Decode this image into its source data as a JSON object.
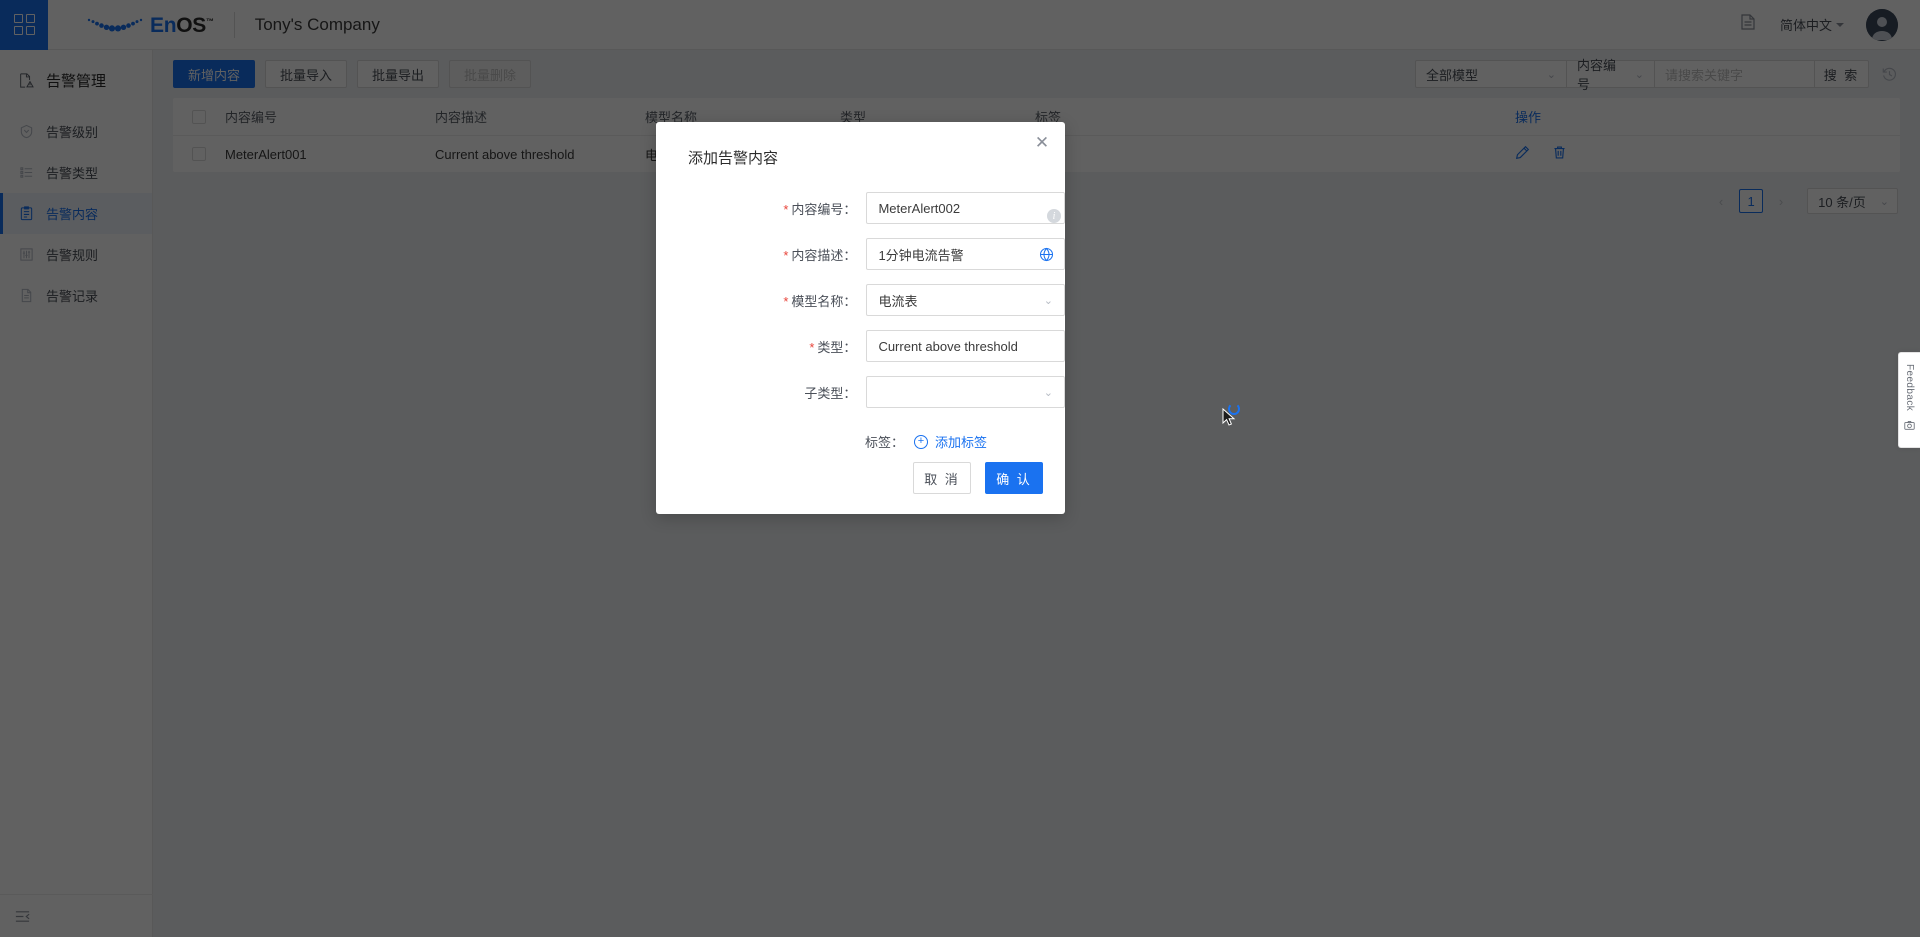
{
  "topbar": {
    "launcher_icon": "grid-launcher-icon",
    "brand_en": "En",
    "brand_os": "OS",
    "brand_tm": "™",
    "company": "Tony's Company",
    "doc_icon": "document-icon",
    "language": "简体中文",
    "avatar_icon": "user-avatar"
  },
  "sidebar": {
    "title": "告警管理",
    "items": [
      {
        "label": "告警级别",
        "icon": "shield-icon",
        "active": false
      },
      {
        "label": "告警类型",
        "icon": "list-icon",
        "active": false
      },
      {
        "label": "告警内容",
        "icon": "clipboard-icon",
        "active": true
      },
      {
        "label": "告警规则",
        "icon": "sliders-icon",
        "active": false
      },
      {
        "label": "告警记录",
        "icon": "file-icon",
        "active": false
      }
    ],
    "collapse_icon": "collapse-sidebar-icon"
  },
  "toolbar": {
    "add_label": "新增内容",
    "import_label": "批量导入",
    "export_label": "批量导出",
    "delete_label": "批量删除",
    "model_filter": "全部模型",
    "field_filter": "内容编号",
    "search_placeholder": "请搜索关键字",
    "search_label": "搜 索",
    "history_icon": "history-icon"
  },
  "table": {
    "columns": [
      "内容编号",
      "内容描述",
      "模型名称",
      "类型",
      "标签",
      "操作"
    ],
    "rows": [
      {
        "code": "MeterAlert001",
        "desc": "Current above threshold",
        "model": "电流表",
        "type": "",
        "tag": "",
        "edit_icon": "edit-icon",
        "delete_icon": "trash-icon"
      }
    ]
  },
  "pagination": {
    "prev_icon": "chevron-left-icon",
    "page": "1",
    "next_icon": "chevron-right-icon",
    "page_size": "10 条/页"
  },
  "feedback": {
    "label": "Feedback",
    "icon": "camera-icon"
  },
  "modal": {
    "title": "添加告警内容",
    "close_icon": "close-icon",
    "info_icon": "info-icon",
    "fields": [
      {
        "label": "内容编号：",
        "required": true,
        "value": "MeterAlert002",
        "kind": "input"
      },
      {
        "label": "内容描述：",
        "required": true,
        "value": "1分钟电流告警",
        "kind": "input-translate"
      },
      {
        "label": "模型名称：",
        "required": true,
        "value": "电流表",
        "kind": "select"
      },
      {
        "label": "类型：",
        "required": true,
        "value": "Current above threshold",
        "kind": "input"
      },
      {
        "label": "子类型：",
        "required": false,
        "value": "",
        "kind": "select"
      }
    ],
    "tag_label": "标签：",
    "add_tag_label": "添加标签",
    "cancel_label": "取 消",
    "confirm_label": "确 认"
  },
  "colors": {
    "accent": "#1a72f0",
    "required": "#e8443a",
    "sidebar_active_bg": "#eff4fd",
    "page_bg": "#f0f2f5",
    "overlay": "rgba(0,0,0,0.62)"
  }
}
